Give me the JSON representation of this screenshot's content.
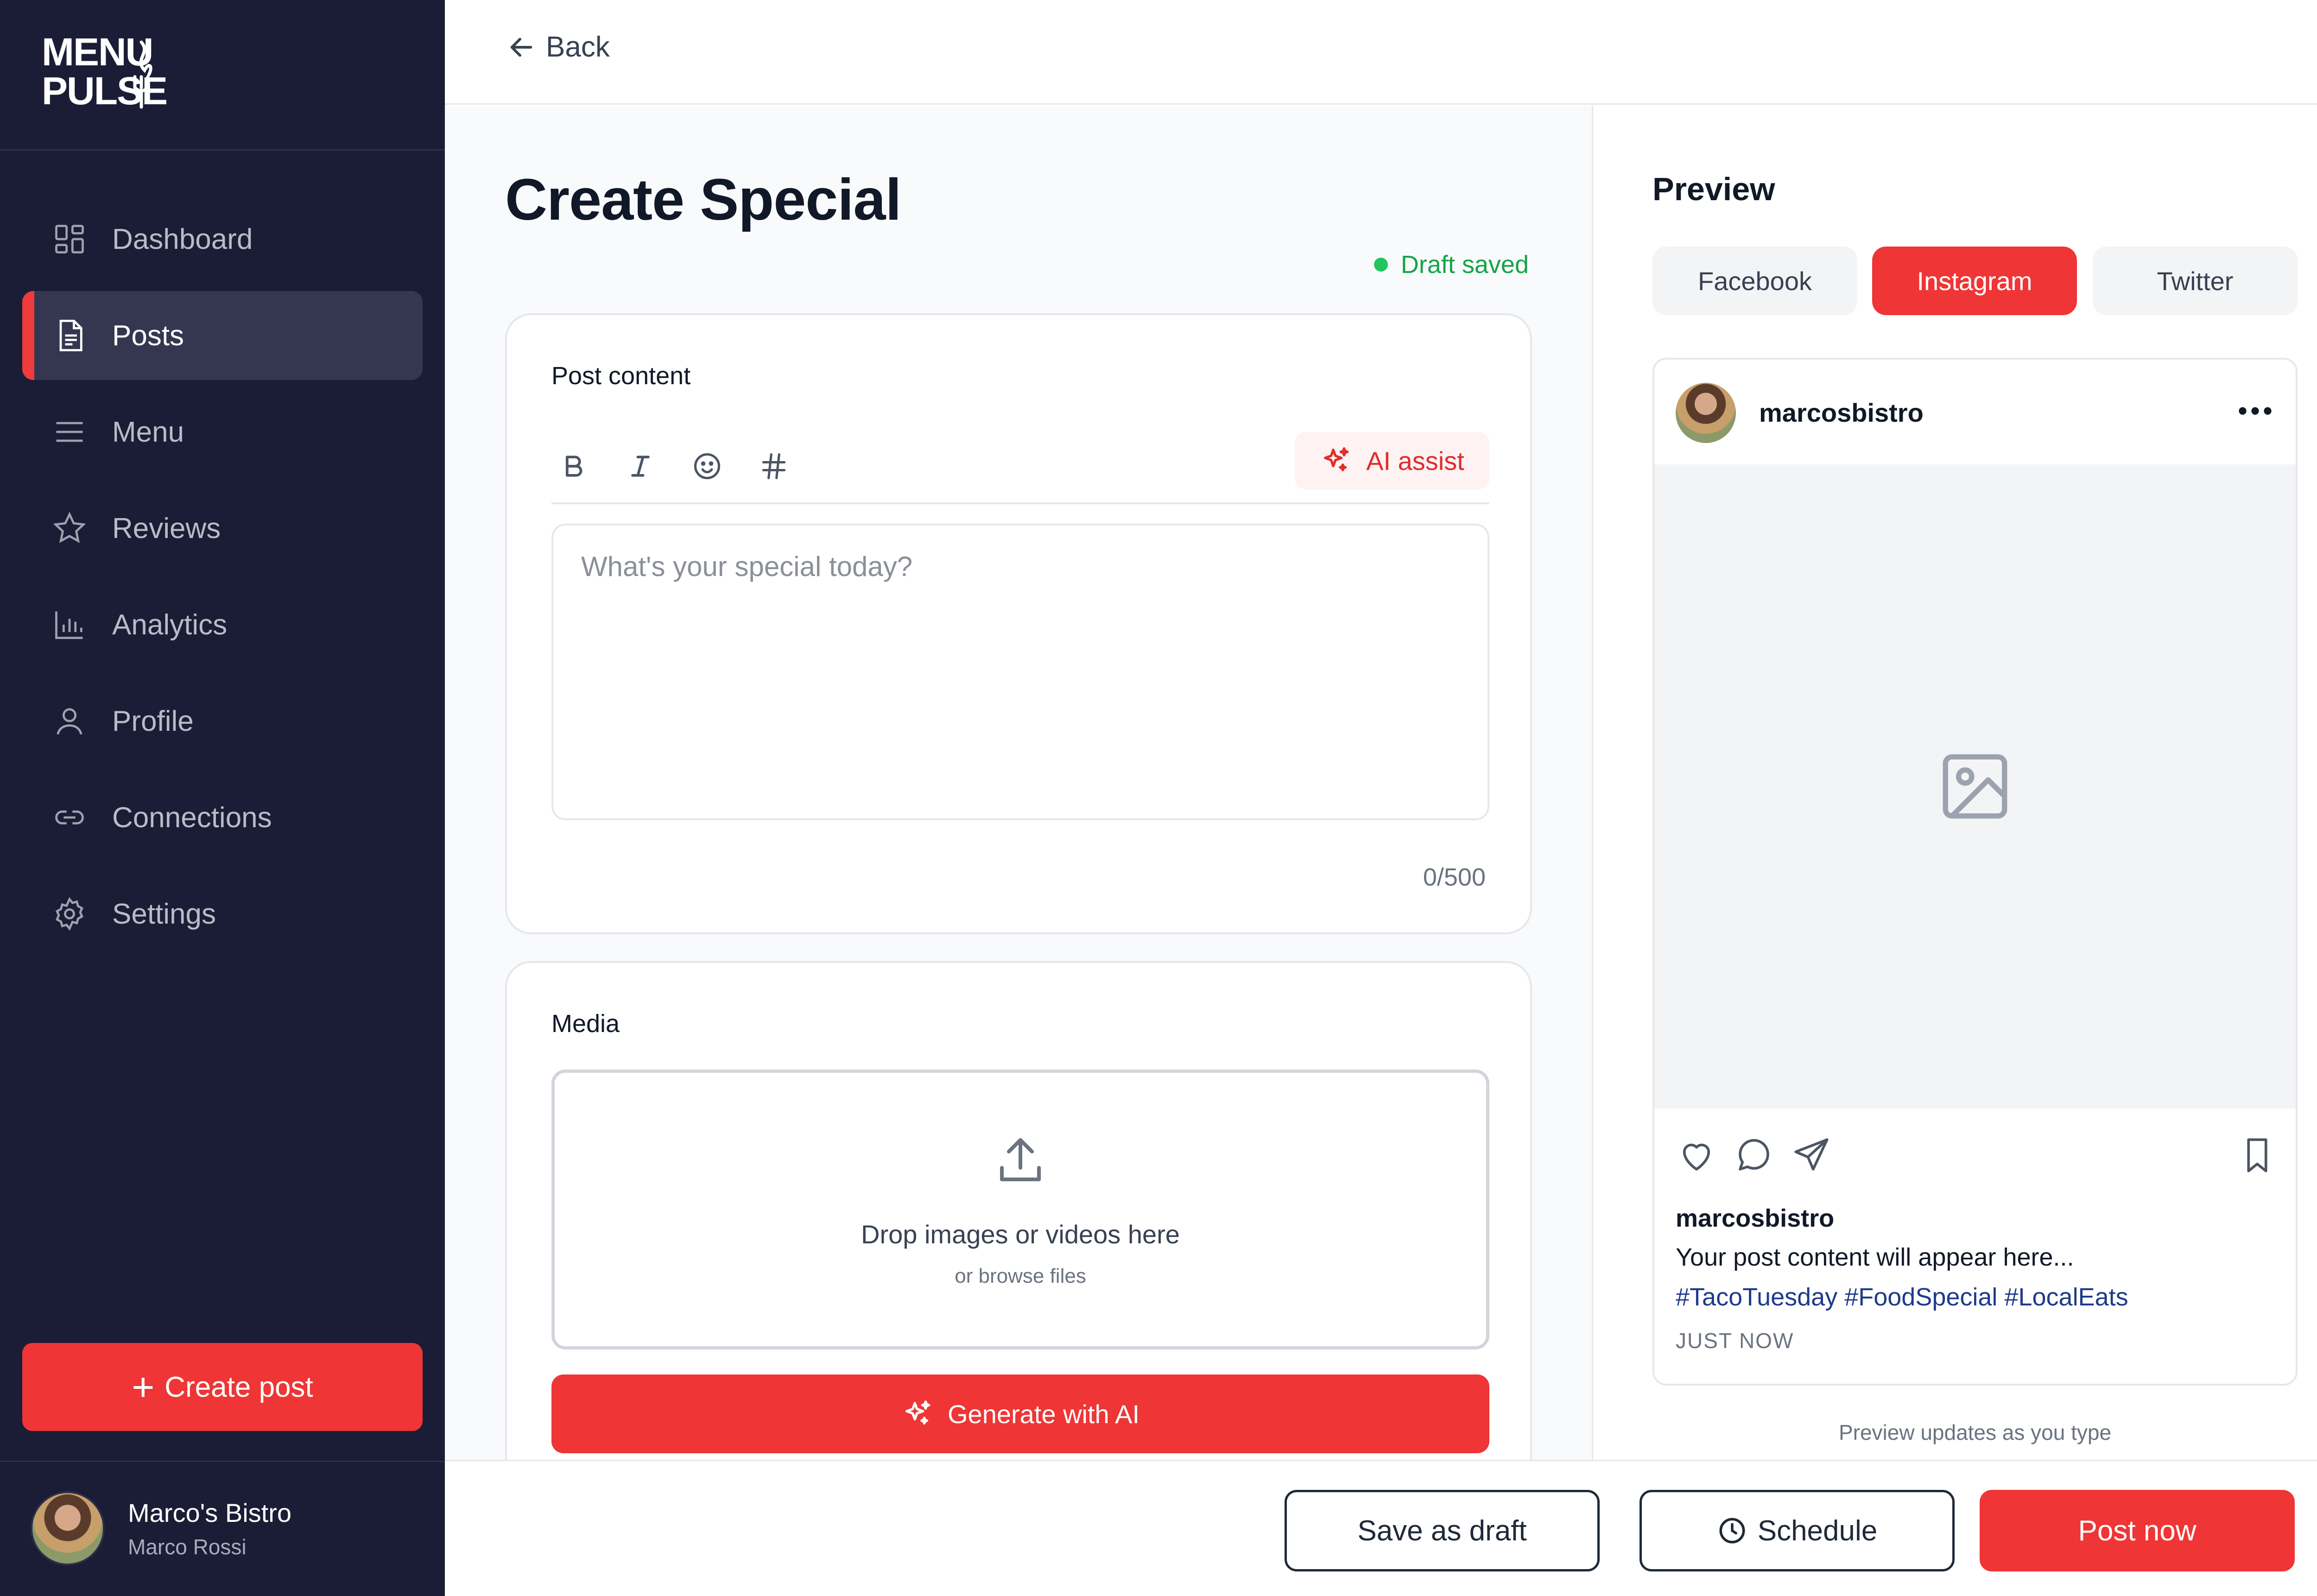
{
  "brand": {
    "logo_line1": "MENU",
    "logo_line2": "PULSE",
    "accent_color": "#ef3535",
    "sidebar_bg": "#1b1d36"
  },
  "sidebar": {
    "items": [
      {
        "label": "Dashboard",
        "icon": "dashboard-grid-icon",
        "active": false
      },
      {
        "label": "Posts",
        "icon": "document-icon",
        "active": true
      },
      {
        "label": "Menu",
        "icon": "hamburger-menu-icon",
        "active": false
      },
      {
        "label": "Reviews",
        "icon": "star-icon",
        "active": false
      },
      {
        "label": "Analytics",
        "icon": "bar-chart-icon",
        "active": false
      },
      {
        "label": "Profile",
        "icon": "user-icon",
        "active": false
      },
      {
        "label": "Connections",
        "icon": "link-icon",
        "active": false
      },
      {
        "label": "Settings",
        "icon": "gear-icon",
        "active": false
      }
    ],
    "create_post_label": "Create post",
    "user": {
      "name": "Marco's Bistro",
      "subtitle": "Marco Rossi"
    }
  },
  "topbar": {
    "back_label": "Back"
  },
  "editor": {
    "title": "Create Special",
    "draft_status": "Draft saved",
    "post_content": {
      "label": "Post content",
      "tools": [
        "B",
        "I",
        "emoji",
        "#"
      ],
      "ai_assist_label": "AI assist",
      "placeholder": "What's your special today?",
      "value": "",
      "counter": "0/500"
    },
    "media": {
      "label": "Media",
      "drop_title": "Drop images or videos here",
      "drop_sub": "or browse files",
      "generate_label": "Generate with AI"
    }
  },
  "preview": {
    "title": "Preview",
    "tabs": [
      {
        "label": "Facebook",
        "active": false
      },
      {
        "label": "Instagram",
        "active": true
      },
      {
        "label": "Twitter",
        "active": false
      }
    ],
    "instagram": {
      "username": "marcosbistro",
      "more": "•••",
      "caption_user": "marcosbistro",
      "caption": "Your post content will appear here...",
      "hashtags": "#TacoTuesday #FoodSpecial #LocalEats",
      "time": "JUST NOW"
    },
    "note": "Preview updates as you type"
  },
  "actions": {
    "save_draft": "Save as draft",
    "schedule": "Schedule",
    "post_now": "Post now"
  }
}
